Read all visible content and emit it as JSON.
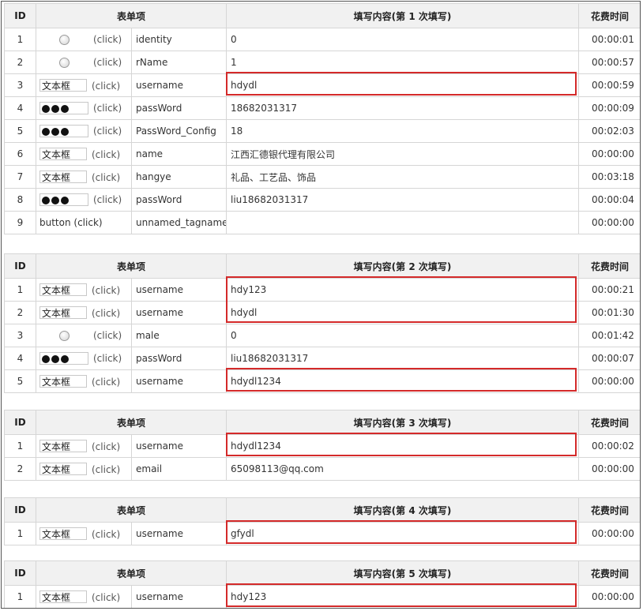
{
  "headers": {
    "id": "ID",
    "item": "表单项",
    "time": "花费时间",
    "content": [
      "填写内容(第 1 次填写)",
      "填写内容(第 2 次填写)",
      "填写内容(第 3 次填写)",
      "填写内容(第 4 次填写)",
      "填写内容(第 5 次填写)"
    ]
  },
  "control_labels": {
    "textbox": "文本框",
    "click": "(click)",
    "button_click": "button (click)"
  },
  "sections": [
    {
      "rows": [
        {
          "id": "1",
          "type": "radio",
          "field": "identity",
          "value": "0",
          "time": "00:00:01"
        },
        {
          "id": "2",
          "type": "radio",
          "field": "rName",
          "value": "1",
          "time": "00:00:57"
        },
        {
          "id": "3",
          "type": "textbox",
          "field": "username",
          "value": "hdydl",
          "time": "00:00:59"
        },
        {
          "id": "4",
          "type": "password",
          "field": "passWord",
          "value": "18682031317",
          "time": "00:00:09"
        },
        {
          "id": "5",
          "type": "password",
          "field": "PassWord_Config",
          "value": "18",
          "time": "00:02:03"
        },
        {
          "id": "6",
          "type": "textbox",
          "field": "name",
          "value": "江西汇德银代理有限公司",
          "time": "00:00:00"
        },
        {
          "id": "7",
          "type": "textbox",
          "field": "hangye",
          "value": "礼品、工艺品、饰品",
          "time": "00:03:18"
        },
        {
          "id": "8",
          "type": "password",
          "field": "passWord",
          "value": "liu18682031317",
          "time": "00:00:04"
        },
        {
          "id": "9",
          "type": "button",
          "field": "unnamed_tagname",
          "value": "",
          "time": "00:00:00"
        }
      ]
    },
    {
      "rows": [
        {
          "id": "1",
          "type": "textbox",
          "field": "username",
          "value": "hdy123",
          "time": "00:00:21"
        },
        {
          "id": "2",
          "type": "textbox",
          "field": "username",
          "value": "hdydl",
          "time": "00:01:30"
        },
        {
          "id": "3",
          "type": "radio",
          "field": "male",
          "value": "0",
          "time": "00:01:42"
        },
        {
          "id": "4",
          "type": "password",
          "field": "passWord",
          "value": "liu18682031317",
          "time": "00:00:07"
        },
        {
          "id": "5",
          "type": "textbox",
          "field": "username",
          "value": "hdydl1234",
          "time": "00:00:00"
        }
      ]
    },
    {
      "rows": [
        {
          "id": "1",
          "type": "textbox",
          "field": "username",
          "value": "hdydl1234",
          "time": "00:00:02"
        },
        {
          "id": "2",
          "type": "textbox",
          "field": "email",
          "value": "65098113@qq.com",
          "time": "00:00:00"
        }
      ]
    },
    {
      "rows": [
        {
          "id": "1",
          "type": "textbox",
          "field": "username",
          "value": "gfydl",
          "time": "00:00:00"
        }
      ]
    },
    {
      "rows": [
        {
          "id": "1",
          "type": "textbox",
          "field": "username",
          "value": "hdy123",
          "time": "00:00:00"
        }
      ]
    }
  ],
  "colors": {
    "highlight": "#d42a2a",
    "header_bg": "#f1f1f1",
    "grid": "#d6d6d6"
  }
}
